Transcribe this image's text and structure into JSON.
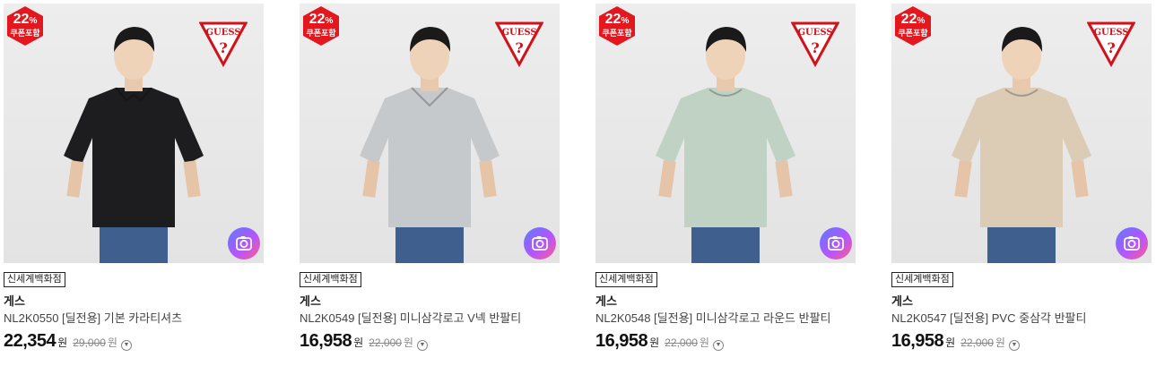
{
  "products": [
    {
      "discount_pct": "22",
      "pct_sign": "%",
      "coupon_label": "쿠폰포함",
      "store": "신세계백화점",
      "brand": "게스",
      "name": "NL2K0550 [딜전용] 기본 카라티셔츠",
      "price": "22,354",
      "currency": "원",
      "original_price": "29,000",
      "shirt_color": "#1d1d1f",
      "shirt_type": "polo"
    },
    {
      "discount_pct": "22",
      "pct_sign": "%",
      "coupon_label": "쿠폰포함",
      "store": "신세계백화점",
      "brand": "게스",
      "name": "NL2K0549 [딜전용] 미니삼각로고 V넥 반팔티",
      "price": "16,958",
      "currency": "원",
      "original_price": "22,000",
      "shirt_color": "#c6c9cc",
      "shirt_type": "vneck"
    },
    {
      "discount_pct": "22",
      "pct_sign": "%",
      "coupon_label": "쿠폰포함",
      "store": "신세계백화점",
      "brand": "게스",
      "name": "NL2K0548 [딜전용] 미니삼각로고 라운드 반팔티",
      "price": "16,958",
      "currency": "원",
      "original_price": "22,000",
      "shirt_color": "#bfd2c4",
      "shirt_type": "round"
    },
    {
      "discount_pct": "22",
      "pct_sign": "%",
      "coupon_label": "쿠폰포함",
      "store": "신세계백화점",
      "brand": "게스",
      "name": "NL2K0547 [딜전용] PVC 중삼각 반팔티",
      "price": "16,958",
      "currency": "원",
      "original_price": "22,000",
      "shirt_color": "#dccbb5",
      "shirt_type": "round"
    }
  ],
  "logo": {
    "text": "GUESS",
    "mark": "?"
  },
  "colors": {
    "badge": "#e4171e",
    "logo_red": "#d0121b"
  }
}
